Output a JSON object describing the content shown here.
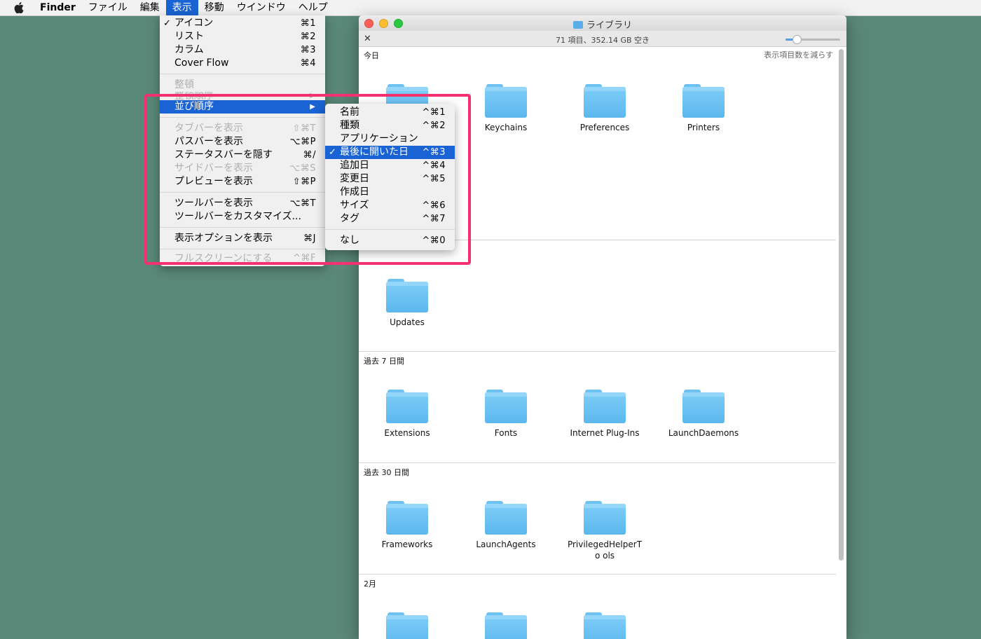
{
  "menubar": {
    "items": [
      "Finder",
      "ファイル",
      "編集",
      "表示",
      "移動",
      "ウインドウ",
      "ヘルプ"
    ],
    "active_index": 3
  },
  "view_menu": {
    "items": [
      {
        "label": "アイコン",
        "shortcut": "⌘1",
        "checked": true
      },
      {
        "label": "リスト",
        "shortcut": "⌘2"
      },
      {
        "label": "カラム",
        "shortcut": "⌘3"
      },
      {
        "label": "Cover Flow",
        "shortcut": "⌘4"
      },
      {
        "label": "整頓",
        "disabled": true
      },
      {
        "label": "整頓順序",
        "disabled": true
      },
      {
        "label": "並び順序",
        "selected": true
      },
      {
        "label": "タブバーを表示",
        "shortcut": "⇧⌘T",
        "disabled": true
      },
      {
        "label": "パスバーを表示",
        "shortcut": "⌥⌘P"
      },
      {
        "label": "ステータスバーを隠す",
        "shortcut": "⌘/"
      },
      {
        "label": "サイドバーを表示",
        "shortcut": "⌥⌘S",
        "disabled": true
      },
      {
        "label": "プレビューを表示",
        "shortcut": "⇧⌘P"
      },
      {
        "label": "ツールバーを表示",
        "shortcut": "⌥⌘T"
      },
      {
        "label": "ツールバーをカスタマイズ...",
        "shortcut": ""
      },
      {
        "label": "表示オプションを表示",
        "shortcut": "⌘J"
      },
      {
        "label": "フルスクリーンにする",
        "shortcut": "^⌘F",
        "disabled": true
      }
    ]
  },
  "sort_submenu": {
    "items": [
      {
        "label": "名前",
        "shortcut": "^⌘1"
      },
      {
        "label": "種類",
        "shortcut": "^⌘2"
      },
      {
        "label": "アプリケーション",
        "shortcut": ""
      },
      {
        "label": "最後に開いた日",
        "shortcut": "^⌘3",
        "checked": true,
        "selected": true
      },
      {
        "label": "追加日",
        "shortcut": "^⌘4"
      },
      {
        "label": "変更日",
        "shortcut": "^⌘5"
      },
      {
        "label": "作成日",
        "shortcut": ""
      },
      {
        "label": "サイズ",
        "shortcut": "^⌘6"
      },
      {
        "label": "タグ",
        "shortcut": "^⌘7"
      },
      {
        "label": "なし",
        "shortcut": "^⌘0"
      }
    ]
  },
  "window": {
    "title": "ライブラリ",
    "status": "71 項目、352.14 GB 空き",
    "zoom_fraction": 0.2
  },
  "sections": [
    {
      "header": "今日",
      "action": "表示項目数を減らす",
      "items": [
        "",
        "Keychains",
        "Preferences",
        "Printers"
      ]
    },
    {
      "header": "",
      "items": [
        "Updates"
      ]
    },
    {
      "header": "過去 7 日間",
      "items": [
        "Extensions",
        "Fonts",
        "Internet Plug-Ins",
        "LaunchDaemons"
      ]
    },
    {
      "header": "過去 30 日間",
      "items": [
        "Frameworks",
        "LaunchAgents",
        "PrivilegedHelperTo ols"
      ]
    },
    {
      "header": "2月",
      "items": [
        "",
        "",
        ""
      ]
    }
  ],
  "colors": {
    "desktop": "#5a8878",
    "selection": "#1a63d4",
    "highlight_border": "#f4306f",
    "folder": "#6ec2f2"
  }
}
